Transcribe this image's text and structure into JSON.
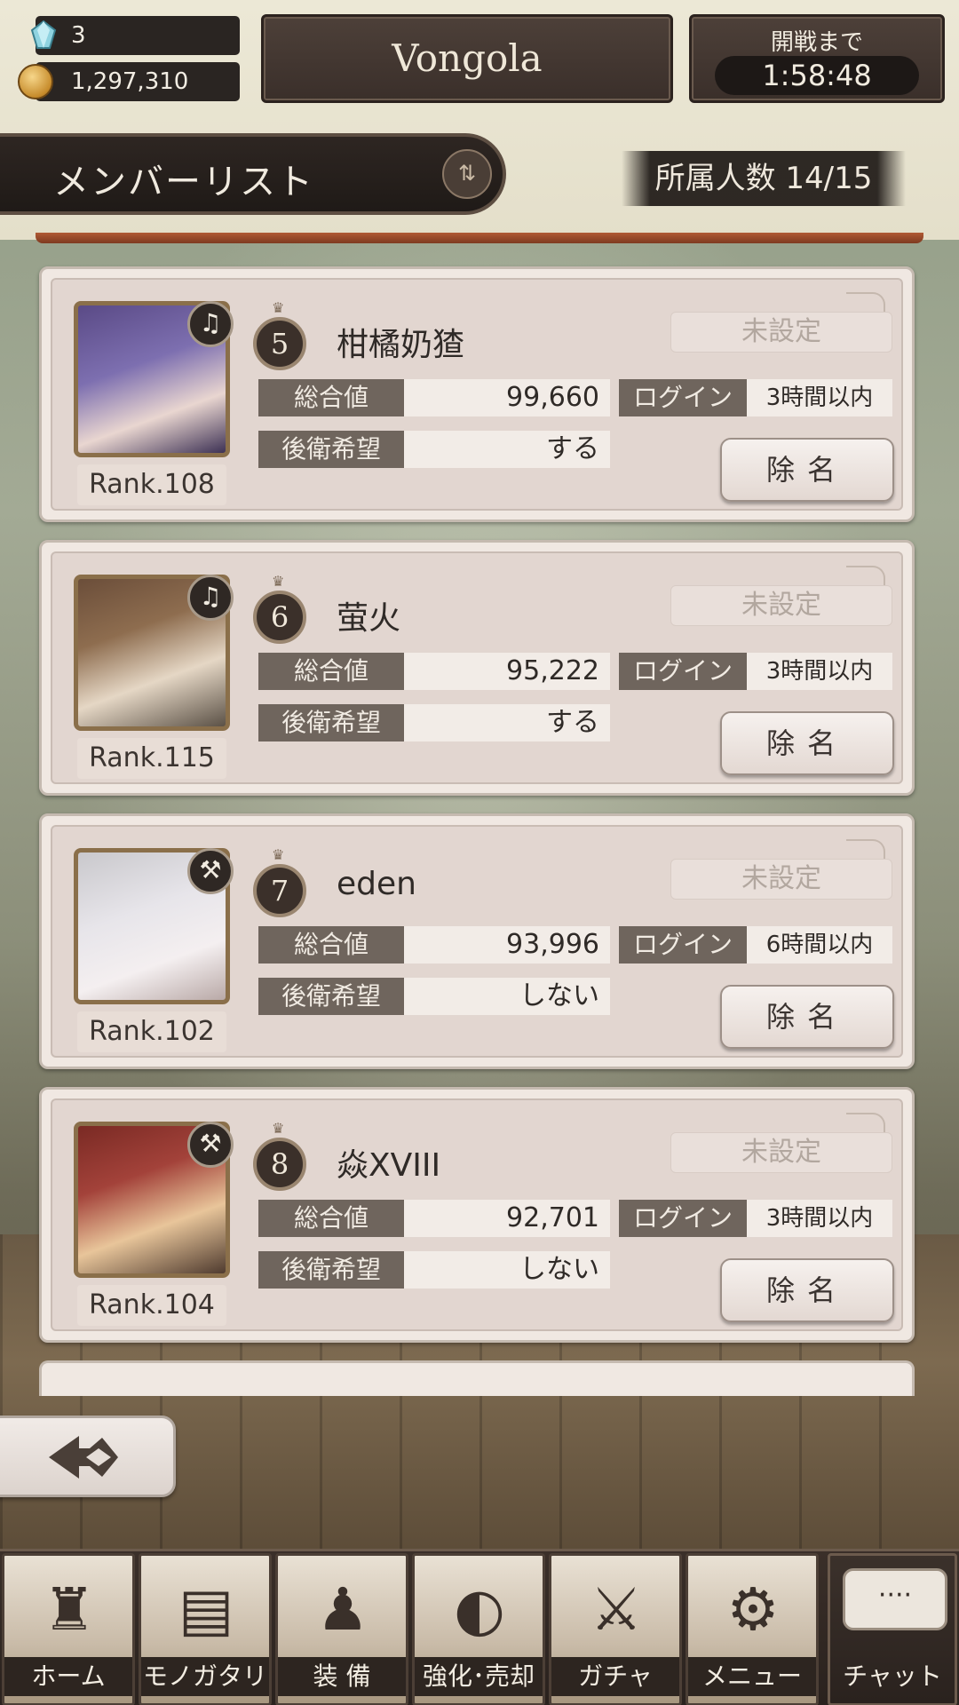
{
  "header": {
    "gems": "3",
    "coins": "1,297,310",
    "guild_name": "Vongola",
    "battle_label": "開戦まで",
    "battle_timer": "1:58:48"
  },
  "section": {
    "title": "メンバーリスト",
    "member_count": "所属人数 14/15"
  },
  "labels": {
    "total": "総合値",
    "rear_wish": "後衛希望",
    "login": "ログイン",
    "remove": "除名"
  },
  "members": [
    {
      "position": "5",
      "name": "柑橘奶猹",
      "rank": "Rank.108",
      "role_status": "未設定",
      "total": "99,660",
      "rear_wish": "する",
      "login": "3時間以内",
      "job_icon": "harp-icon"
    },
    {
      "position": "6",
      "name": "萤火",
      "rank": "Rank.115",
      "role_status": "未設定",
      "total": "95,222",
      "rear_wish": "する",
      "login": "3時間以内",
      "job_icon": "harp-icon"
    },
    {
      "position": "7",
      "name": "eden",
      "rank": "Rank.102",
      "role_status": "未設定",
      "total": "93,996",
      "rear_wish": "しない",
      "login": "6時間以内",
      "job_icon": "hammer-icon"
    },
    {
      "position": "8",
      "name": "焱XVIII",
      "rank": "Rank.104",
      "role_status": "未設定",
      "total": "92,701",
      "rear_wish": "しない",
      "login": "3時間以内",
      "job_icon": "hammer-icon"
    }
  ],
  "nav": [
    {
      "label": "ホーム",
      "icon": "castle-icon"
    },
    {
      "label": "モノガタリ",
      "icon": "book-icon"
    },
    {
      "label": "装 備",
      "icon": "puppet-icon"
    },
    {
      "label": "強化･売却",
      "icon": "mask-icon"
    },
    {
      "label": "ガチャ",
      "icon": "crossed-swords-icon"
    },
    {
      "label": "メニュー",
      "icon": "gears-icon"
    }
  ],
  "chat": {
    "label": "チャット",
    "bubble": "····"
  }
}
